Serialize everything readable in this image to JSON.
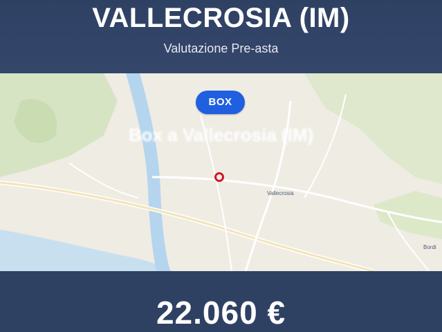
{
  "header": {
    "title": "VALLECROSIA (IM)",
    "subtitle": "Valutazione Pre-asta"
  },
  "map": {
    "badge": "BOX",
    "overlay_title": "Box a Vallecrosia (IM)",
    "town_label": "Vallecrosia",
    "edge_label": "Bordi",
    "pin_color": "#d0182a",
    "badge_color": "#1f5fe0"
  },
  "price": "22.060 €",
  "colors": {
    "banner": "#2f4163",
    "sea": "#c8dff0",
    "river": "#b5d5ee",
    "green": "#cfe2b9"
  }
}
